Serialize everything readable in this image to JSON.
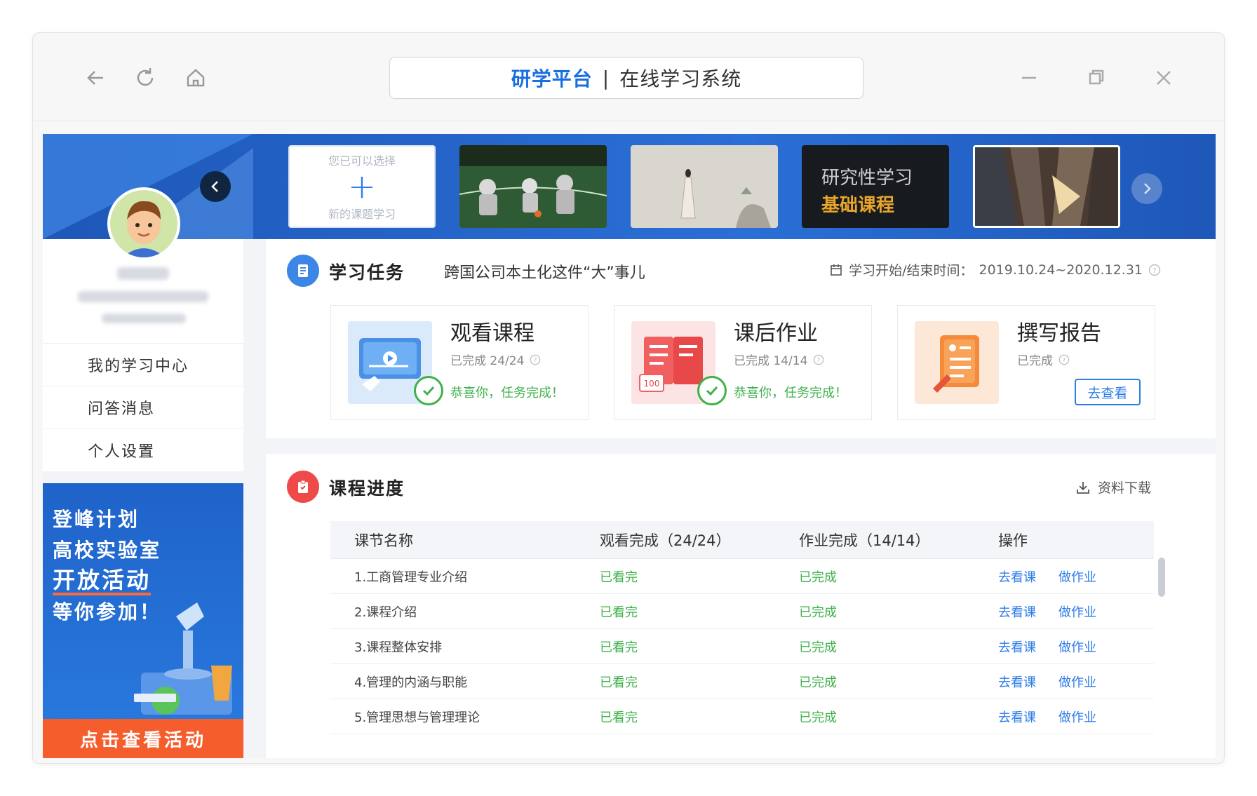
{
  "window": {
    "title_brand": "研学平台",
    "title_sep": "|",
    "title_sub": "在线学习系统"
  },
  "banner": {
    "add_thumb": {
      "line1": "您已可以选择",
      "plus": "+",
      "line2": "新的课题学习"
    },
    "course_thumb_text": {
      "line1": "研究性学习",
      "line2": "基础课程"
    }
  },
  "sidebar": {
    "menu": [
      {
        "label": "我的学习中心"
      },
      {
        "label": "问答消息"
      },
      {
        "label": "个人设置"
      }
    ],
    "promo": {
      "line1": "登峰计划",
      "line2": "高校实验室",
      "line3": "开放活动",
      "line4": "等你参加！",
      "cta": "点击查看活动"
    }
  },
  "tasks": {
    "title": "学习任务",
    "subject": "跨国公司本土化这件“大”事儿",
    "time_label": "学习开始/结束时间：",
    "time_value": "2019.10.24~2020.12.31",
    "cards": [
      {
        "name": "观看课程",
        "count": "已完成 24/24",
        "status": "恭喜你，任务完成！"
      },
      {
        "name": "课后作业",
        "count": "已完成 14/14",
        "status": "恭喜你，任务完成！"
      },
      {
        "name": "撰写报告",
        "count": "已完成",
        "button": "去查看"
      }
    ]
  },
  "progress": {
    "title": "课程进度",
    "download": "资料下载",
    "columns": [
      "课节名称",
      "观看完成（24/24）",
      "作业完成（14/14）",
      "操作"
    ],
    "rows": [
      {
        "name": "1.工商管理专业介绍",
        "watch": "已看完",
        "homework": "已完成",
        "op1": "去看课",
        "op2": "做作业"
      },
      {
        "name": "2.课程介绍",
        "watch": "已看完",
        "homework": "已完成",
        "op1": "去看课",
        "op2": "做作业"
      },
      {
        "name": "3.课程整体安排",
        "watch": "已看完",
        "homework": "已完成",
        "op1": "去看课",
        "op2": "做作业"
      },
      {
        "name": "4.管理的内涵与职能",
        "watch": "已看完",
        "homework": "已完成",
        "op1": "去看课",
        "op2": "做作业"
      },
      {
        "name": "5.管理思想与管理理论",
        "watch": "已看完",
        "homework": "已完成",
        "op1": "去看课",
        "op2": "做作业"
      }
    ]
  },
  "colors": {
    "accent": "#2f7ce8",
    "success": "#3fb14b",
    "banner": "#1e57b8",
    "cta": "#f55d2c"
  }
}
